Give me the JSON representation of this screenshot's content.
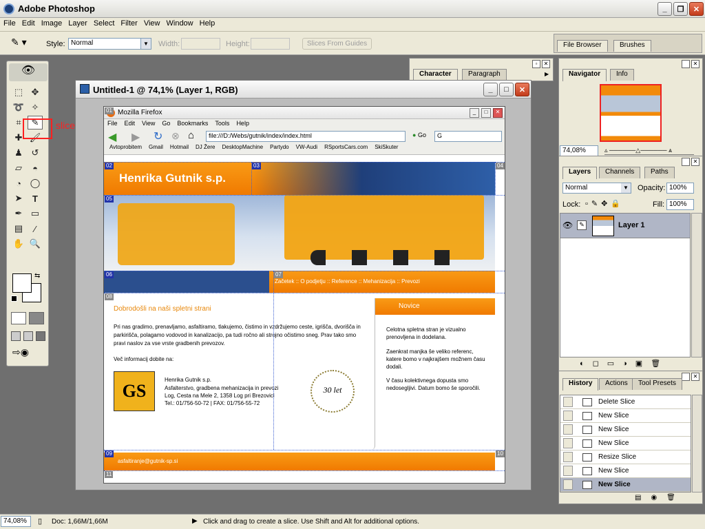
{
  "app": {
    "title": "Adobe Photoshop"
  },
  "menu": [
    "File",
    "Edit",
    "Image",
    "Layer",
    "Select",
    "Filter",
    "View",
    "Window",
    "Help"
  ],
  "options": {
    "style_label": "Style:",
    "style_value": "Normal",
    "width_label": "Width:",
    "height_label": "Height:",
    "slices_from_guides": "Slices From Guides",
    "tabs": [
      "File Browser",
      "Brushes"
    ]
  },
  "annotation": {
    "text": "slice tool",
    "color": "#ff2020"
  },
  "document": {
    "title": "Untitled-1 @ 74,1% (Layer 1, RGB)",
    "slice_labels": [
      "01",
      "02",
      "03",
      "04",
      "05",
      "06",
      "07",
      "08",
      "09",
      "10",
      "11"
    ]
  },
  "firefox": {
    "title": "Mozilla Firefox",
    "menu": [
      "File",
      "Edit",
      "View",
      "Go",
      "Bookmarks",
      "Tools",
      "Help"
    ],
    "address": "file:///D:/Webs/gutnik/index/index.html",
    "go": "Go",
    "bookmarks": [
      "Avtoprobitem",
      "Gmail",
      "Hotmail",
      "DJ Žere",
      "DesktopMachine",
      "Partydo",
      "VW-Audi",
      "RSportsCars.com",
      "SkiSkuter"
    ]
  },
  "site": {
    "brand": "Henrika Gutnik s.p.",
    "nav": [
      "Začetek",
      "O podjetju",
      "Reference",
      "Mehanizacija",
      "Prevozi"
    ],
    "welcome_title": "Dobrodošli na naši spletni strani",
    "welcome_text": "Pri nas gradimo, prenavljamo, asfaltiramo, tlakujemo, čistimo in vzdržujemo ceste, igrišča, dvorišča in parkirišča, polagamo vodovod in kanalizacijo, pa tudi ročno ali strojno očistimo sneg. Prav tako smo pravi naslov za vse vrste gradbenih prevozov.",
    "more_info": "Več informacij dobite na:",
    "contact_name": "Henrika Gutnik s.p.",
    "contact_desc": "Asfalterstvo, gradbena mehanizacija in prevozi",
    "contact_addr": "Log, Cesta na Mele 2, 1358 Log pri Brezovici",
    "contact_tel": "Tel.: 01/756-50-72 | FAX: 01/756-55-72",
    "news_title": "Novice",
    "news_p1": "Celotna spletna stran je vizualno prenovljena in dodelana.",
    "news_p2": "Zaenkrat manjka še veliko referenc, katere bomo v najkrajšem možnem času dodali.",
    "news_p3": "V času kolektivnega dopusta smo nedosegljivi. Datum bomo še sporočili.",
    "email": "asfaltiranje@gutnik-sp.si",
    "badge": "30 let"
  },
  "character_panel": {
    "tabs": [
      "Character",
      "Paragraph"
    ]
  },
  "navigator": {
    "tabs": [
      "Navigator",
      "Info"
    ],
    "zoom": "74,08%"
  },
  "layers": {
    "tabs": [
      "Layers",
      "Channels",
      "Paths"
    ],
    "blend": "Normal",
    "opacity_label": "Opacity:",
    "opacity": "100%",
    "lock_label": "Lock:",
    "fill_label": "Fill:",
    "fill": "100%",
    "layer_name": "Layer 1"
  },
  "history": {
    "tabs": [
      "History",
      "Actions",
      "Tool Presets"
    ],
    "items": [
      "Delete Slice",
      "New Slice",
      "New Slice",
      "New Slice",
      "Resize Slice",
      "New Slice",
      "New Slice"
    ]
  },
  "status": {
    "zoom": "74,08%",
    "doc": "Doc: 1,66M/1,66M",
    "hint": "Click and drag to create a slice. Use Shift and Alt for additional options."
  }
}
